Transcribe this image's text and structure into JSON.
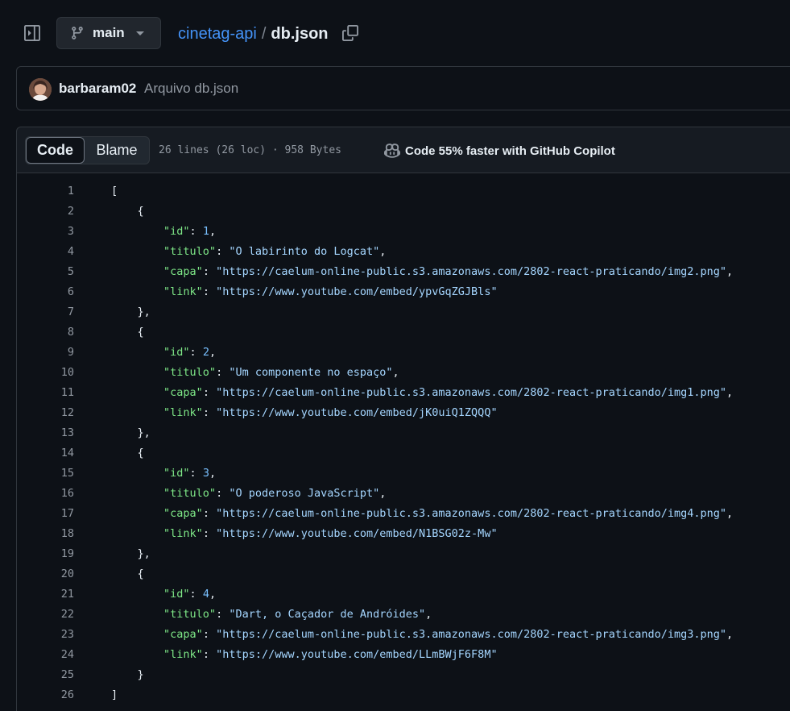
{
  "header": {
    "branch": "main",
    "repo": "cinetag-api",
    "separator": "/",
    "file": "db.json"
  },
  "commit": {
    "author": "barbaram02",
    "message": "Arquivo db.json"
  },
  "file_header": {
    "tab_code": "Code",
    "tab_blame": "Blame",
    "info": "26 lines (26 loc) · 958 Bytes",
    "copilot": "Code 55% faster with GitHub Copilot"
  },
  "code": {
    "lines": [
      [
        {
          "t": "p",
          "v": "["
        }
      ],
      [
        {
          "t": "p",
          "v": "    {"
        }
      ],
      [
        {
          "t": "p",
          "v": "        "
        },
        {
          "t": "k",
          "v": "\"id\""
        },
        {
          "t": "p",
          "v": ": "
        },
        {
          "t": "n",
          "v": "1"
        },
        {
          "t": "p",
          "v": ","
        }
      ],
      [
        {
          "t": "p",
          "v": "        "
        },
        {
          "t": "k",
          "v": "\"titulo\""
        },
        {
          "t": "p",
          "v": ": "
        },
        {
          "t": "s",
          "v": "\"O labirinto do Logcat\""
        },
        {
          "t": "p",
          "v": ","
        }
      ],
      [
        {
          "t": "p",
          "v": "        "
        },
        {
          "t": "k",
          "v": "\"capa\""
        },
        {
          "t": "p",
          "v": ": "
        },
        {
          "t": "s",
          "v": "\"https://caelum-online-public.s3.amazonaws.com/2802-react-praticando/img2.png\""
        },
        {
          "t": "p",
          "v": ","
        }
      ],
      [
        {
          "t": "p",
          "v": "        "
        },
        {
          "t": "k",
          "v": "\"link\""
        },
        {
          "t": "p",
          "v": ": "
        },
        {
          "t": "s",
          "v": "\"https://www.youtube.com/embed/ypvGqZGJBls\""
        }
      ],
      [
        {
          "t": "p",
          "v": "    },"
        }
      ],
      [
        {
          "t": "p",
          "v": "    {"
        }
      ],
      [
        {
          "t": "p",
          "v": "        "
        },
        {
          "t": "k",
          "v": "\"id\""
        },
        {
          "t": "p",
          "v": ": "
        },
        {
          "t": "n",
          "v": "2"
        },
        {
          "t": "p",
          "v": ","
        }
      ],
      [
        {
          "t": "p",
          "v": "        "
        },
        {
          "t": "k",
          "v": "\"titulo\""
        },
        {
          "t": "p",
          "v": ": "
        },
        {
          "t": "s",
          "v": "\"Um componente no espaço\""
        },
        {
          "t": "p",
          "v": ","
        }
      ],
      [
        {
          "t": "p",
          "v": "        "
        },
        {
          "t": "k",
          "v": "\"capa\""
        },
        {
          "t": "p",
          "v": ": "
        },
        {
          "t": "s",
          "v": "\"https://caelum-online-public.s3.amazonaws.com/2802-react-praticando/img1.png\""
        },
        {
          "t": "p",
          "v": ","
        }
      ],
      [
        {
          "t": "p",
          "v": "        "
        },
        {
          "t": "k",
          "v": "\"link\""
        },
        {
          "t": "p",
          "v": ": "
        },
        {
          "t": "s",
          "v": "\"https://www.youtube.com/embed/jK0uiQ1ZQQQ\""
        }
      ],
      [
        {
          "t": "p",
          "v": "    },"
        }
      ],
      [
        {
          "t": "p",
          "v": "    {"
        }
      ],
      [
        {
          "t": "p",
          "v": "        "
        },
        {
          "t": "k",
          "v": "\"id\""
        },
        {
          "t": "p",
          "v": ": "
        },
        {
          "t": "n",
          "v": "3"
        },
        {
          "t": "p",
          "v": ","
        }
      ],
      [
        {
          "t": "p",
          "v": "        "
        },
        {
          "t": "k",
          "v": "\"titulo\""
        },
        {
          "t": "p",
          "v": ": "
        },
        {
          "t": "s",
          "v": "\"O poderoso JavaScript\""
        },
        {
          "t": "p",
          "v": ","
        }
      ],
      [
        {
          "t": "p",
          "v": "        "
        },
        {
          "t": "k",
          "v": "\"capa\""
        },
        {
          "t": "p",
          "v": ": "
        },
        {
          "t": "s",
          "v": "\"https://caelum-online-public.s3.amazonaws.com/2802-react-praticando/img4.png\""
        },
        {
          "t": "p",
          "v": ","
        }
      ],
      [
        {
          "t": "p",
          "v": "        "
        },
        {
          "t": "k",
          "v": "\"link\""
        },
        {
          "t": "p",
          "v": ": "
        },
        {
          "t": "s",
          "v": "\"https://www.youtube.com/embed/N1BSG02z-Mw\""
        }
      ],
      [
        {
          "t": "p",
          "v": "    },"
        }
      ],
      [
        {
          "t": "p",
          "v": "    {"
        }
      ],
      [
        {
          "t": "p",
          "v": "        "
        },
        {
          "t": "k",
          "v": "\"id\""
        },
        {
          "t": "p",
          "v": ": "
        },
        {
          "t": "n",
          "v": "4"
        },
        {
          "t": "p",
          "v": ","
        }
      ],
      [
        {
          "t": "p",
          "v": "        "
        },
        {
          "t": "k",
          "v": "\"titulo\""
        },
        {
          "t": "p",
          "v": ": "
        },
        {
          "t": "s",
          "v": "\"Dart, o Caçador de Andróides\""
        },
        {
          "t": "p",
          "v": ","
        }
      ],
      [
        {
          "t": "p",
          "v": "        "
        },
        {
          "t": "k",
          "v": "\"capa\""
        },
        {
          "t": "p",
          "v": ": "
        },
        {
          "t": "s",
          "v": "\"https://caelum-online-public.s3.amazonaws.com/2802-react-praticando/img3.png\""
        },
        {
          "t": "p",
          "v": ","
        }
      ],
      [
        {
          "t": "p",
          "v": "        "
        },
        {
          "t": "k",
          "v": "\"link\""
        },
        {
          "t": "p",
          "v": ": "
        },
        {
          "t": "s",
          "v": "\"https://www.youtube.com/embed/LLmBWjF6F8M\""
        }
      ],
      [
        {
          "t": "p",
          "v": "    }"
        }
      ],
      [
        {
          "t": "p",
          "v": "]"
        }
      ]
    ]
  },
  "icons": {
    "sidebar_toggle": "sidebar-collapse-icon",
    "branch": "git-branch-icon",
    "caret": "triangle-down-icon",
    "copy": "copy-icon",
    "copilot": "copilot-icon"
  },
  "colors": {
    "background": "#0d1117",
    "link": "#4493f8",
    "key": "#7ee787",
    "string": "#a5d6ff",
    "number": "#79c0ff",
    "muted": "#9198a1",
    "border": "#30363d"
  }
}
